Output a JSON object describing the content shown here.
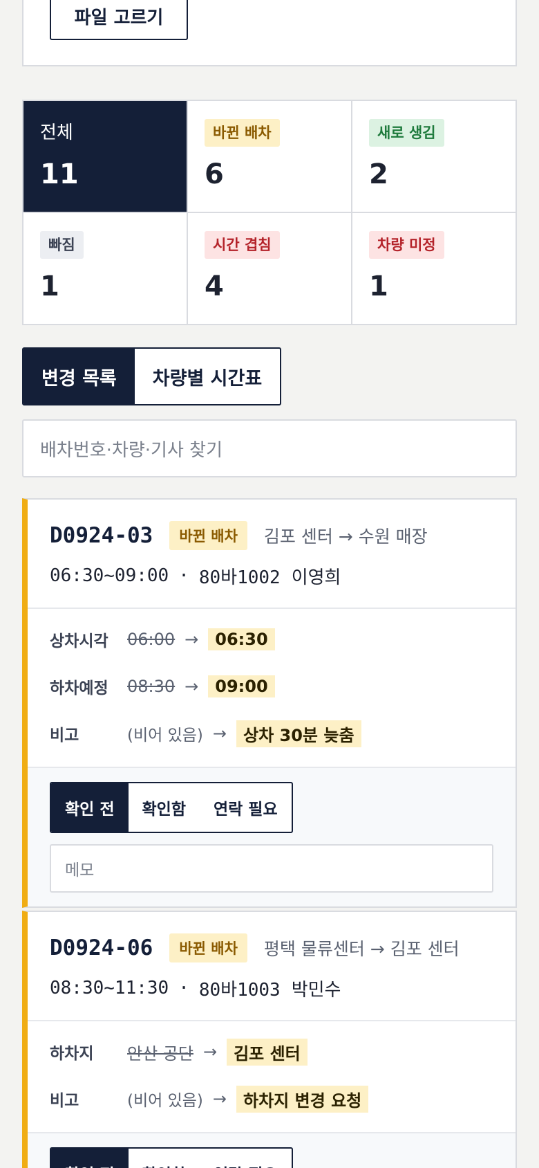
{
  "upload": {
    "file_button": "파일 고르기"
  },
  "stats": {
    "total": {
      "label": "전체",
      "count": "11"
    },
    "changed": {
      "label": "바뀐 배차",
      "count": "6"
    },
    "new": {
      "label": "새로 생김",
      "count": "2"
    },
    "missing": {
      "label": "빠짐",
      "count": "1"
    },
    "overlap": {
      "label": "시간 겹침",
      "count": "4"
    },
    "unassigned": {
      "label": "차량 미정",
      "count": "1"
    }
  },
  "tabs": [
    {
      "label": "변경 목록",
      "active": true
    },
    {
      "label": "차량별 시간표",
      "active": false
    }
  ],
  "search": {
    "placeholder": "배차번호·차량·기사 찾기"
  },
  "cards": [
    {
      "id": "D0924-03",
      "status": "바뀐 배차",
      "route": "김포 센터 → 수원 매장",
      "time": "06:30~09:00",
      "sep": "·",
      "vehicle": "80바1002",
      "driver": "이영희",
      "changes": [
        {
          "label": "상차시각",
          "old": "06:00",
          "arrow": "→",
          "new": "06:30"
        },
        {
          "label": "하차예정",
          "old": "08:30",
          "arrow": "→",
          "new": "09:00"
        },
        {
          "label": "비고",
          "old": "(비어 있음)",
          "arrow": "→",
          "new": "상차 30분 늦춤"
        }
      ],
      "review": [
        "확인 전",
        "확인함",
        "연락 필요"
      ],
      "memo_placeholder": "메모"
    },
    {
      "id": "D0924-06",
      "status": "바뀐 배차",
      "route": "평택 물류센터 → 김포 센터",
      "time": "08:30~11:30",
      "sep": "·",
      "vehicle": "80바1003",
      "driver": "박민수",
      "changes": [
        {
          "label": "하차지",
          "old": "안산 공단",
          "arrow": "→",
          "new": "김포 센터"
        },
        {
          "label": "비고",
          "old": "(비어 있음)",
          "arrow": "→",
          "new": "하차지 변경 요청"
        }
      ],
      "review": [
        "확인 전",
        "확인함",
        "연락 필요"
      ]
    }
  ],
  "colors": {
    "accent": "#141f38",
    "changed_stripe": "#f0ad14",
    "changed_pill_bg": "#fdf0c6"
  }
}
